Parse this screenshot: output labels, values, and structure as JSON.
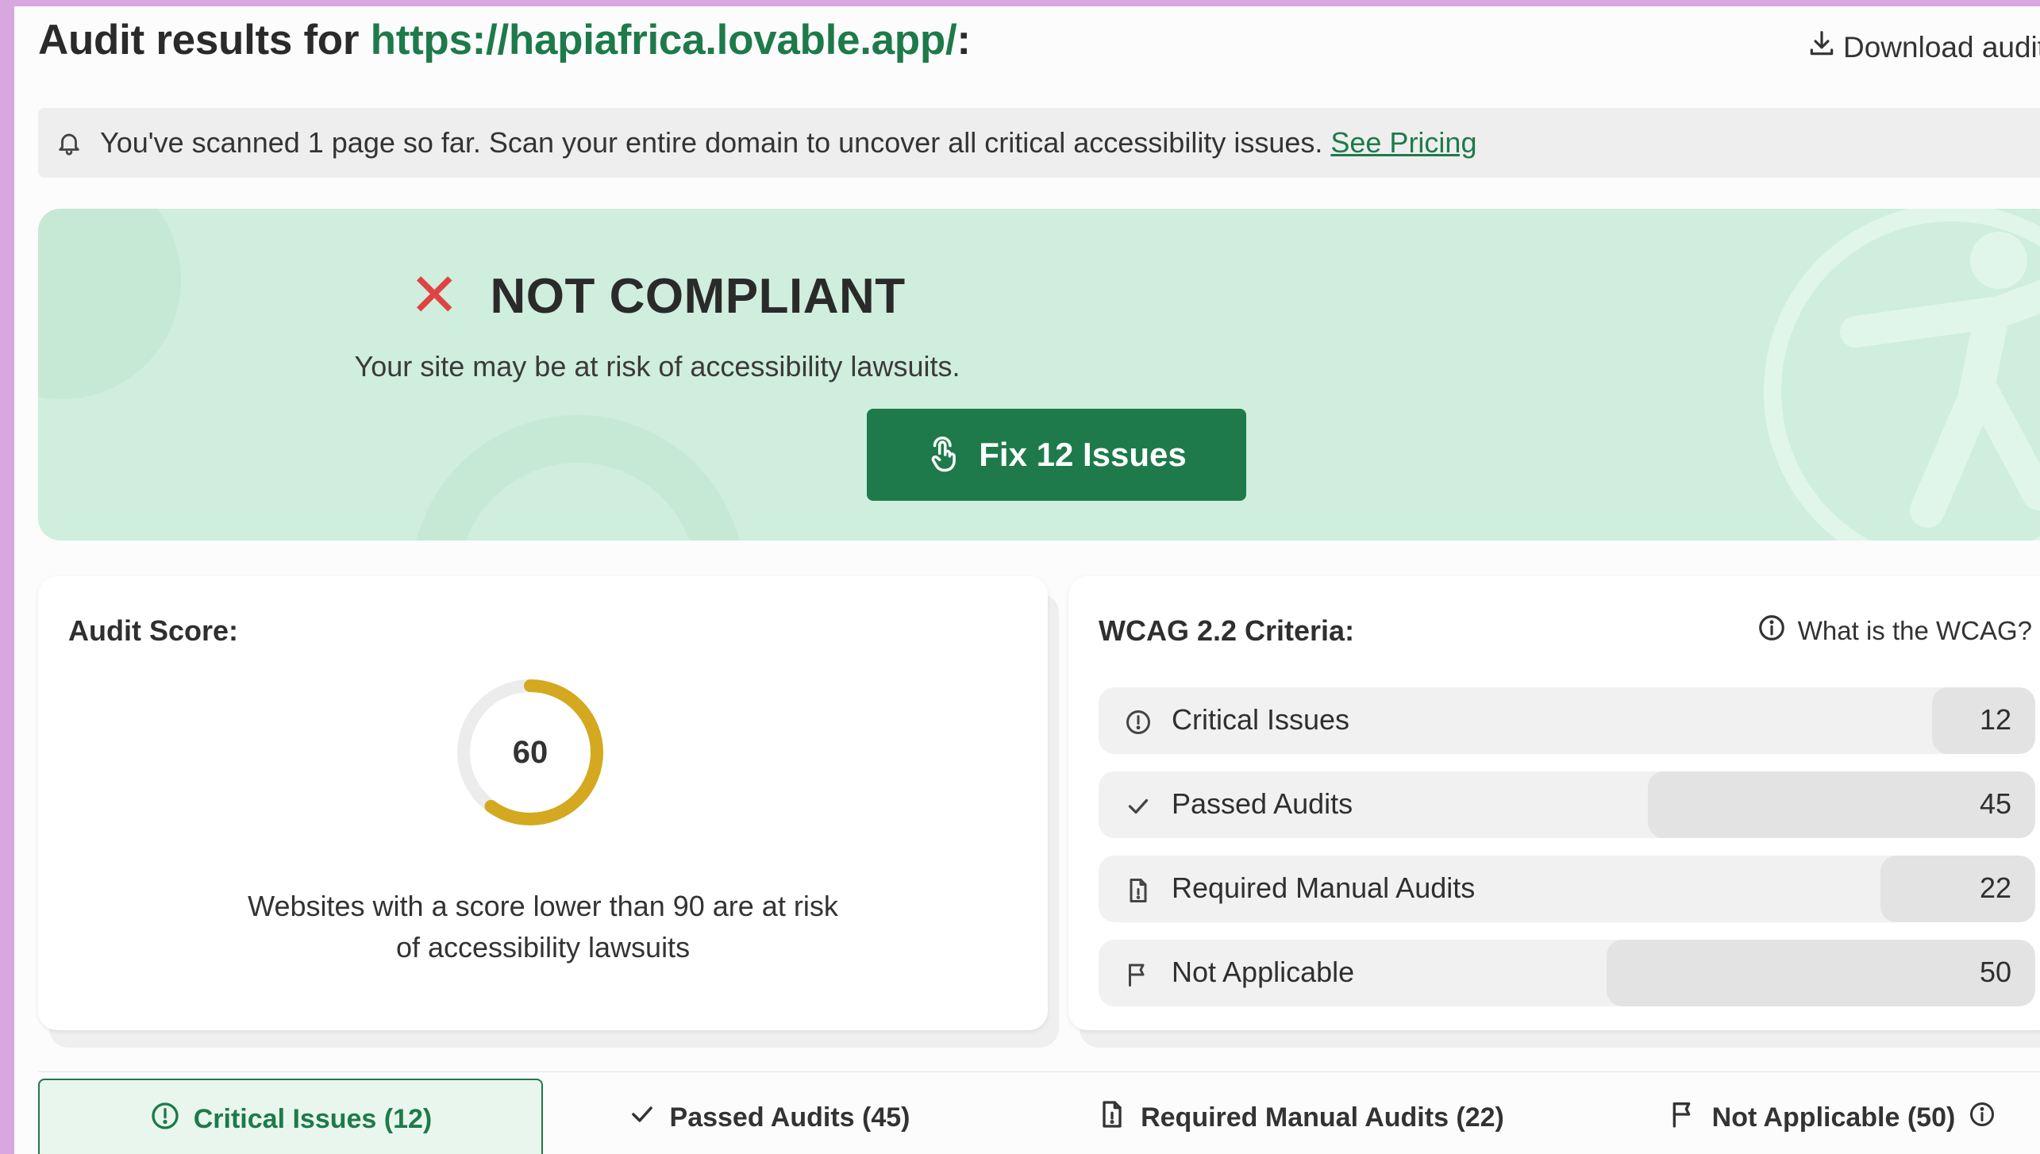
{
  "header": {
    "title_prefix": "Audit results for ",
    "url": "https://hapiafrica.lovable.app/",
    "title_suffix": ":",
    "download_label": "Download audit"
  },
  "notice": {
    "text": "You've scanned 1 page so far. Scan your entire domain to uncover all critical accessibility issues.",
    "link": "See Pricing"
  },
  "hero": {
    "status": "NOT COMPLIANT",
    "subtitle": "Your site may be at risk of accessibility lawsuits.",
    "fix_button": "Fix 12 Issues"
  },
  "score": {
    "title": "Audit Score:",
    "value": 60,
    "max": 100,
    "gauge_color": "#d4a91f",
    "description_line1": "Websites with a score lower than 90 are at risk",
    "description_line2": "of accessibility lawsuits"
  },
  "wcag": {
    "title": "WCAG 2.2 Criteria:",
    "help": "What is the WCAG?",
    "rows": [
      {
        "label": "Critical Issues",
        "value": "12",
        "icon": "alert-circle-icon"
      },
      {
        "label": "Passed Audits",
        "value": "45",
        "icon": "check-icon"
      },
      {
        "label": "Required Manual Audits",
        "value": "22",
        "icon": "document-icon"
      },
      {
        "label": "Not Applicable",
        "value": "50",
        "icon": "flag-icon"
      }
    ]
  },
  "tabs": [
    {
      "label": "Critical Issues (12)",
      "icon": "alert-circle-icon",
      "active": true
    },
    {
      "label": "Passed Audits (45)",
      "icon": "check-icon",
      "active": false
    },
    {
      "label": "Required Manual Audits (22)",
      "icon": "document-icon",
      "active": false
    },
    {
      "label": "Not Applicable (50)",
      "icon": "flag-icon",
      "active": false
    }
  ],
  "colors": {
    "brand_green": "#1e7a4a",
    "hero_bg": "#cfeedd",
    "error_red": "#e04343",
    "gauge": "#d4a91f"
  }
}
